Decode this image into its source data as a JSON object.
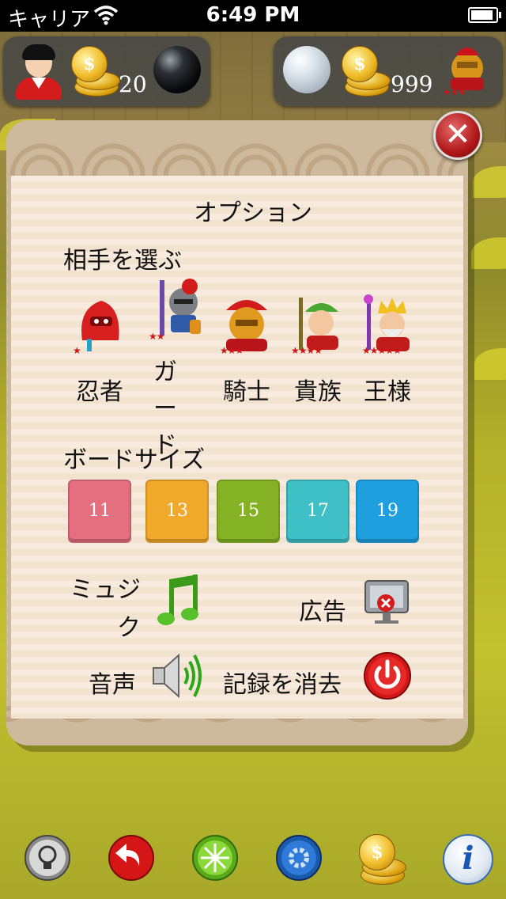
{
  "status_bar": {
    "carrier": "キャリア",
    "time": "6:49 PM",
    "battery_level": 0.9
  },
  "hud": {
    "player_coins": "20",
    "opponent_coins": "999",
    "coin_symbol": "$"
  },
  "options": {
    "title": "オプション",
    "choose_opponent_label": "相手を選ぶ",
    "opponents": [
      {
        "label": "忍者",
        "stars": "★"
      },
      {
        "label": "ガード",
        "stars": "★★"
      },
      {
        "label": "騎士",
        "stars": "★★★"
      },
      {
        "label": "貴族",
        "stars": "★★★★"
      },
      {
        "label": "王様",
        "stars": "★★★★★"
      }
    ],
    "board_size_label": "ボードサイズ",
    "board_sizes": [
      {
        "value": "11",
        "color": "#e36f7f"
      },
      {
        "value": "13",
        "color": "#f0a92a"
      },
      {
        "value": "15",
        "color": "#85b224"
      },
      {
        "value": "17",
        "color": "#3fbfc6"
      },
      {
        "value": "19",
        "color": "#1e9fe0"
      }
    ],
    "music_label": "ミュジク",
    "sound_label": "音声",
    "ads_label": "広告",
    "erase_records_label": "記録を消去",
    "close_symbol": "✕"
  },
  "toolbar": {
    "info_symbol": "i",
    "coin_symbol": "$"
  }
}
